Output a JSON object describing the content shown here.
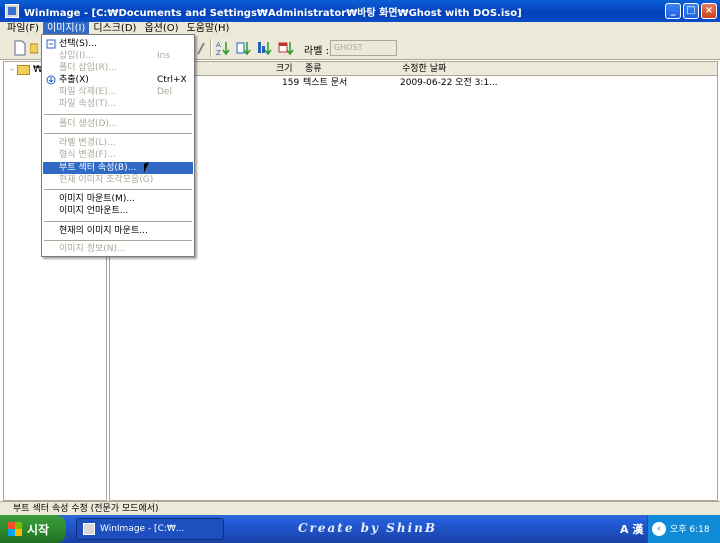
{
  "window": {
    "title": "WinImage - [C:₩Documents and Settings₩Administrator₩바탕 화면₩Ghost with DOS.iso]",
    "min_label": "_",
    "max_label": "□",
    "close_label": "×"
  },
  "menubar": [
    {
      "label": "파일(F)"
    },
    {
      "label": "이미지(I)"
    },
    {
      "label": "디스크(D)"
    },
    {
      "label": "옵션(O)"
    },
    {
      "label": "도움말(H)"
    }
  ],
  "toolbar": {
    "label_text": "라벨 :",
    "label_placeholder": "GHOST"
  },
  "tree": {
    "root_label": "₩"
  },
  "file_list": {
    "columns": [
      "크기",
      "종류",
      "수정한 날짜"
    ],
    "rows": [
      {
        "size": "159",
        "type": "텍스트 문서",
        "modified": "2009-06-22 오전 3:1..."
      }
    ]
  },
  "image_menu": [
    {
      "label": "선택(S)...",
      "shortcut": "",
      "disabled": false,
      "icon": "select"
    },
    {
      "label": "삽입(I)...",
      "shortcut": "Ins",
      "disabled": true
    },
    {
      "label": "폴더 삽입(R)...",
      "shortcut": "",
      "disabled": true
    },
    {
      "label": "추출(X)",
      "shortcut": "Ctrl+X",
      "disabled": false,
      "icon": "extract"
    },
    {
      "label": "파일 삭제(E)...",
      "shortcut": "Del",
      "disabled": true
    },
    {
      "label": "파일 속성(T)...",
      "shortcut": "",
      "disabled": true
    },
    {
      "label": "폴더 생성(D)...",
      "shortcut": "",
      "disabled": true
    },
    {
      "label": "라벨 변경(L)...",
      "shortcut": "",
      "disabled": true
    },
    {
      "label": "형식 변경(F)...",
      "shortcut": "",
      "disabled": true
    },
    {
      "label": "부트 섹터 속성(B)...",
      "shortcut": "",
      "disabled": false,
      "highlighted": true
    },
    {
      "label": "현재 이미지 조각모음(G)",
      "shortcut": "",
      "disabled": true
    },
    {
      "label": "이미지 마운트(M)...",
      "shortcut": "",
      "disabled": false
    },
    {
      "label": "이미지 언마운트...",
      "shortcut": "",
      "disabled": false
    },
    {
      "label": "현재의 이미지 마운트...",
      "shortcut": "",
      "disabled": false
    },
    {
      "label": "이미지 정보(N)...",
      "shortcut": "",
      "disabled": true
    }
  ],
  "statusbar": {
    "text": "부트 섹터 속성 수정 (전문가 모드에서)"
  },
  "taskbar": {
    "start_label": "시작",
    "task_label": "WinImage - [C:₩...",
    "credit": "Create by ShinB",
    "ime": "A 漢",
    "clock": "오후 6:18"
  },
  "colors": {
    "title_blue": "#0540b8",
    "menu_highlight": "#316ac5",
    "chrome": "#ece9d8",
    "start_green": "#2f8b2f",
    "tray_blue": "#0f8ad6"
  }
}
